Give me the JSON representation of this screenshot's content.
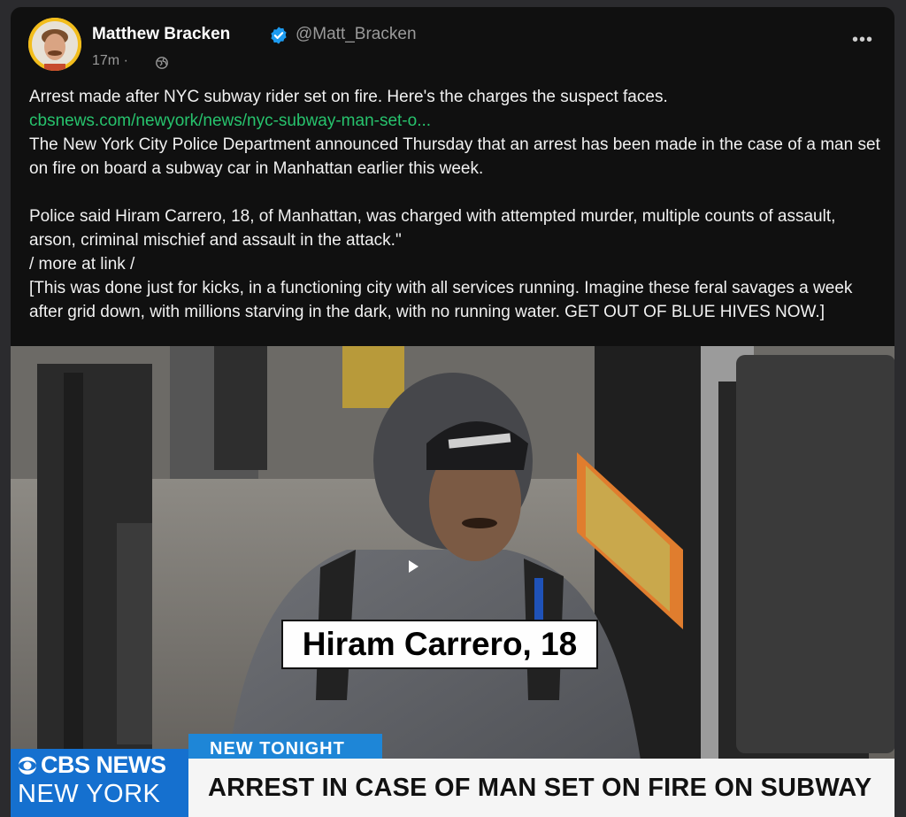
{
  "post": {
    "author_name": "Matthew Bracken",
    "handle": "@Matt_Bracken",
    "time": "17m ·",
    "more_label": "•••",
    "verified": true,
    "colors": {
      "link": "#27c36d",
      "verified": "#1d9bf0",
      "background": "#101010"
    },
    "text": {
      "line1": "Arrest made after NYC subway rider set on fire. Here's the charges the suspect faces.",
      "link": "cbsnews.com/newyork/news/nyc-subway-man-set-o...",
      "para1": "The New York City Police Department announced Thursday that an arrest has been made in the case of a man set on fire on board a subway car in Manhattan earlier this week.",
      "para2": "Police said Hiram Carrero, 18, of Manhattan, was charged with attempted murder, multiple counts of assault, arson, criminal mischief and assault in the attack.\"",
      "more": "/ more at link /",
      "comment": "[This was done just for kicks, in a functioning city with all services running. Imagine these feral savages a week after grid down, with millions starving in the dark, with no running water. GET OUT OF BLUE HIVES NOW.]"
    }
  },
  "video": {
    "name_caption": "Hiram Carrero, 18",
    "new_tonight": "NEW TONIGHT",
    "network": "CBS NEWS",
    "station": "NEW YORK",
    "headline": "ARREST IN CASE OF MAN SET ON FIRE ON SUBWAY",
    "play_icon": "play-icon",
    "colors": {
      "cbs_blue": "#1570cf",
      "new_tonight": "#1e86d7"
    }
  }
}
